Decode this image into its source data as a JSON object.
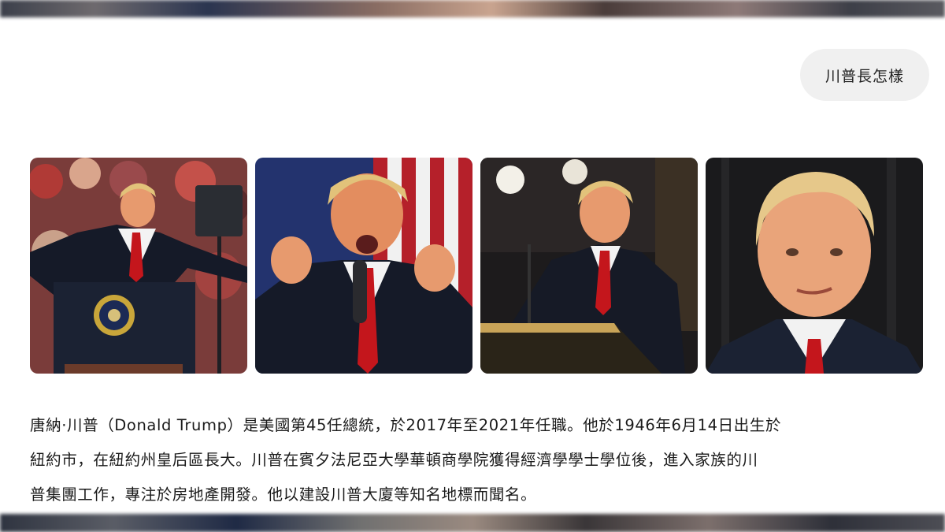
{
  "query": {
    "text": "川普長怎樣"
  },
  "gallery": {
    "photos": [
      {
        "icon": "person-photo",
        "alt": ""
      },
      {
        "icon": "person-photo",
        "alt": ""
      },
      {
        "icon": "person-photo",
        "alt": ""
      },
      {
        "icon": "person-photo",
        "alt": ""
      }
    ]
  },
  "answer": {
    "lines": [
      "唐納·川普（Donald Trump）是美國第45任總統，於2017年至2021年任職。他於1946年6月14日出生於",
      "紐約市，在紐約州皇后區長大。川普在賓夕法尼亞大學華頓商學院獲得經濟學學士學位後，進入家族的川",
      "普集團工作，專注於房地產開發。他以建設川普大廈等知名地標而聞名。"
    ]
  },
  "colors": {
    "suit": "#1b2233",
    "tie": "#c4161c",
    "hair": "#e2c27a",
    "skin": "#e79a6e",
    "flag_red": "#b5202a",
    "flag_blue": "#23336e"
  }
}
